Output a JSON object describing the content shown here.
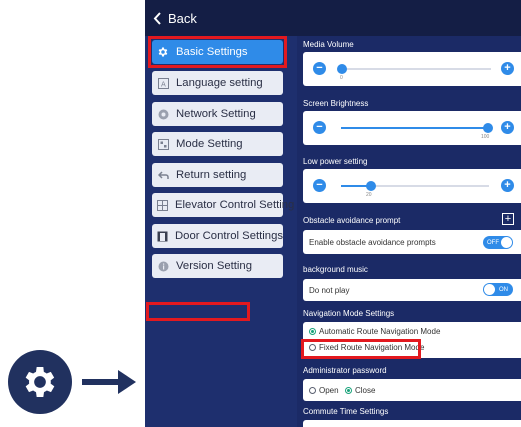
{
  "topbar": {
    "back_label": "Back"
  },
  "sidebar": {
    "items": [
      {
        "label": "Basic Settings"
      },
      {
        "label": "Language setting"
      },
      {
        "label": "Network Setting"
      },
      {
        "label": "Mode Setting"
      },
      {
        "label": "Return setting"
      },
      {
        "label": "Elevator Control Setting"
      },
      {
        "label": "Door Control Settings"
      },
      {
        "label": "Version Setting"
      }
    ]
  },
  "settings": {
    "media_volume": {
      "title": "Media Volume",
      "value": 0
    },
    "screen_brightness": {
      "title": "Screen Brightness",
      "value": 100
    },
    "low_power": {
      "title": "Low power setting",
      "value": 20
    },
    "obstacle": {
      "title": "Obstacle avoidance prompt",
      "label": "Enable obstacle avoidance prompts",
      "toggle_label": "OFF"
    },
    "background_music": {
      "title": "background music",
      "label": "Do not play",
      "toggle_label": "ON"
    },
    "navigation_mode": {
      "title": "Navigation Mode Settings",
      "options": [
        {
          "label": "Automatic Route Navigation Mode",
          "selected": true
        },
        {
          "label": "Fixed Route Navigation Mode",
          "selected": false
        }
      ]
    },
    "admin_password": {
      "title": "Administrator password",
      "options": [
        {
          "label": "Open",
          "selected": false
        },
        {
          "label": "Close",
          "selected": true
        }
      ]
    },
    "commute": {
      "title": "Commute Time Settings"
    }
  },
  "colors": {
    "accent": "#2f8be8",
    "highlight": "#e3191f",
    "sidebar": "#1e2f6e",
    "background": "#1b2a66"
  },
  "icons": [
    "gear-icon",
    "arrow-right-icon",
    "back-chevron-icon",
    "plus-icon",
    "minus-icon"
  ]
}
